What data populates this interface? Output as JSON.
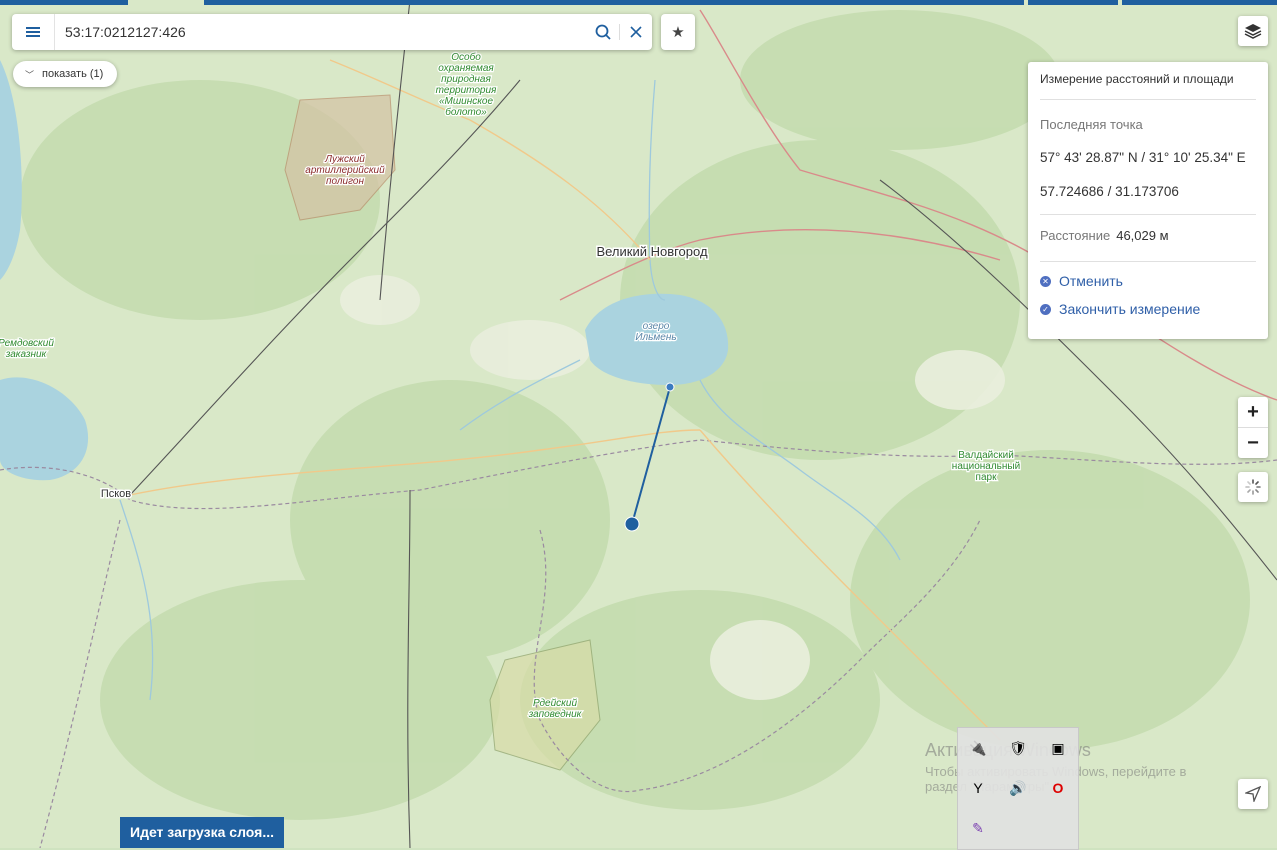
{
  "search": {
    "value": "53:17:0212127:426"
  },
  "filter_button": {
    "label": "показать (1)"
  },
  "map_labels": {
    "city_novgorod": "Великий Новгород",
    "city_pskov": "Псков",
    "lake_ilmen": [
      "озеро",
      "Ильмень"
    ],
    "reserve_mshinskoe": [
      "Особо",
      "охраняемая",
      "природная",
      "территория",
      "«Мшинское",
      "болото»"
    ],
    "polygon_luga": [
      "Лужский",
      "артиллерийский",
      "полигон"
    ],
    "remdovsky": [
      "Ремдовский",
      "заказник"
    ],
    "valdai": [
      "Валдайский",
      "национальный",
      "парк"
    ],
    "rdeisky": [
      "Рдейский",
      "заповедник"
    ]
  },
  "measure_panel": {
    "title": "Измерение расстояний и площади",
    "last_point_label": "Последняя точка",
    "coords_dms": "57° 43' 28.87\" N / 31° 10' 25.34\" E",
    "coords_decimal": "57.724686 / 31.173706",
    "distance_label": "Расстояние",
    "distance_value": "46,029 м",
    "cancel_label": "Отменить",
    "finish_label": "Закончить измерение"
  },
  "zoom": {
    "in_label": "+",
    "out_label": "−"
  },
  "loading": {
    "text": "Идет загрузка слоя..."
  },
  "watermark": {
    "line1": "Активация Windows",
    "line2": "Чтобы активировать Windows, перейдите в",
    "line3": "раздел \"Параметры\"."
  },
  "icons": [
    "menu-icon",
    "search-icon",
    "close-icon",
    "star-icon",
    "layers-icon",
    "spinner-icon",
    "locate-icon"
  ],
  "colors": {
    "accent": "#1f5f9f",
    "water": "#aad3df",
    "forest": "#c5ddb2",
    "measure_line": "#1f5f9f"
  }
}
